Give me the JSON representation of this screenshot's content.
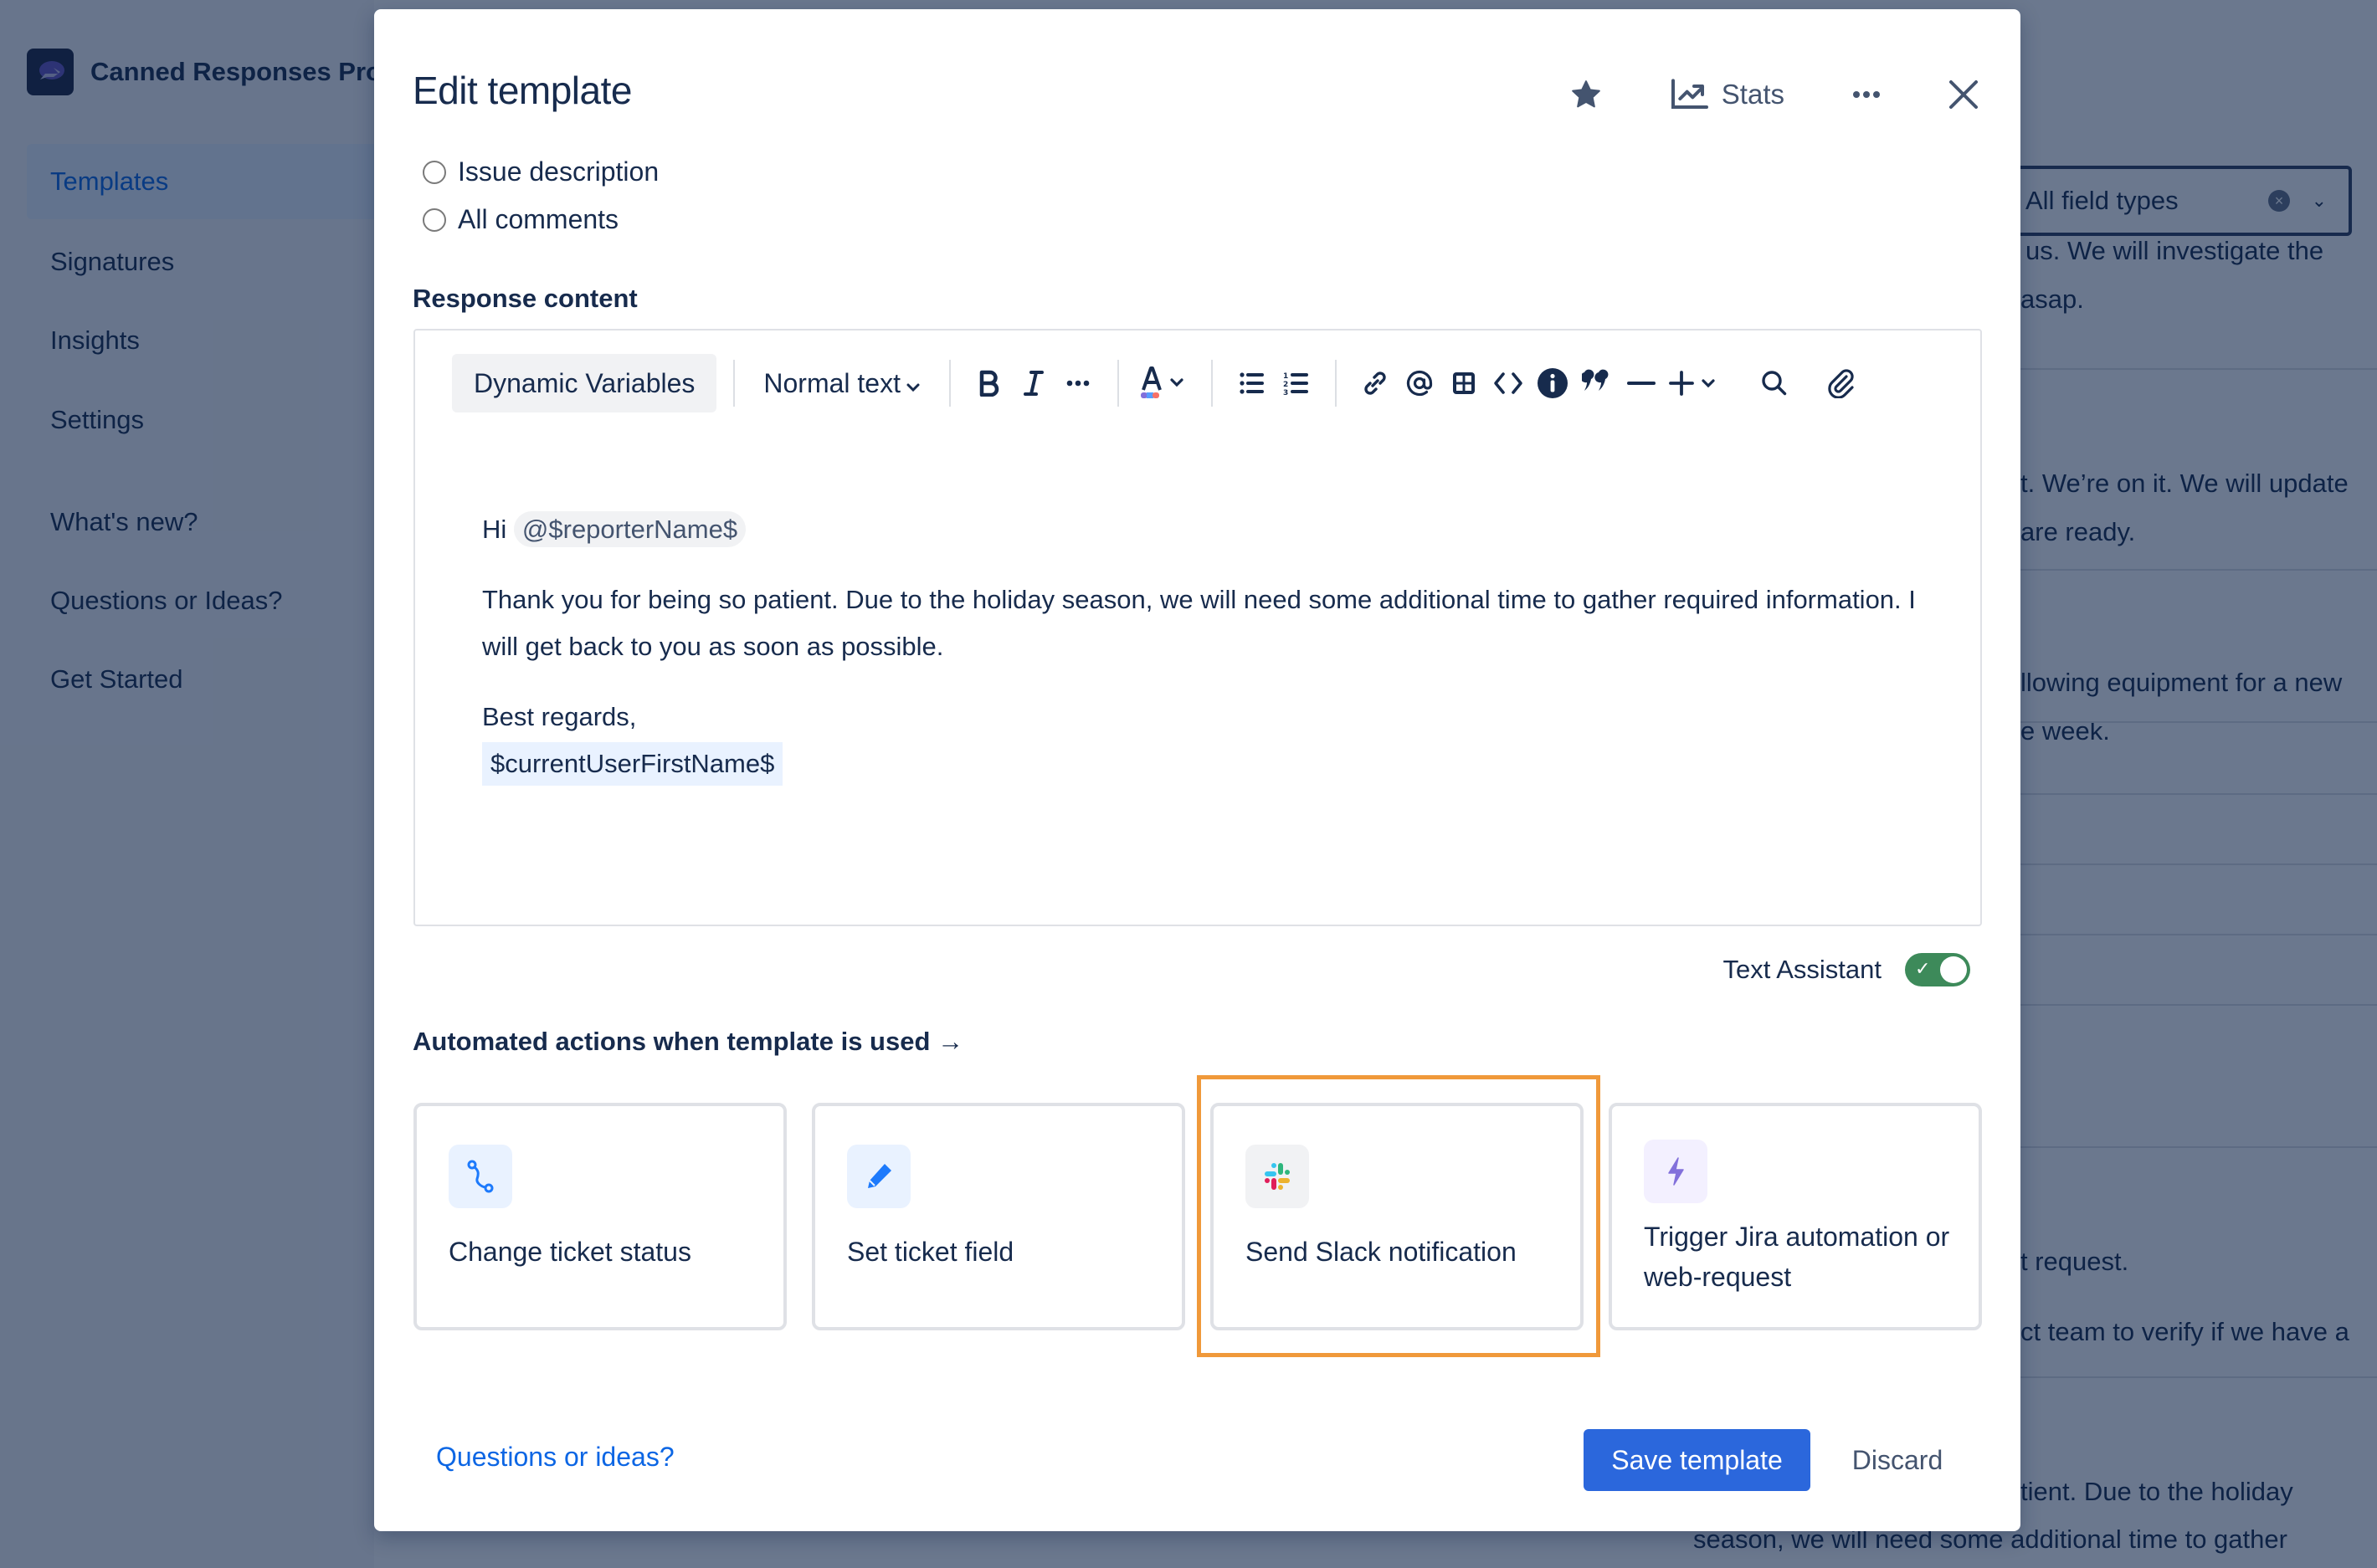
{
  "app": {
    "name": "Canned Responses Pro",
    "sidebar": {
      "items": [
        {
          "label": "Templates",
          "active": true
        },
        {
          "label": "Signatures"
        },
        {
          "label": "Insights"
        },
        {
          "label": "Settings"
        },
        {
          "label": "What's new?"
        },
        {
          "label": "Questions or Ideas?"
        },
        {
          "label": "Get Started"
        }
      ]
    },
    "background": {
      "filter_select": {
        "value": "All field types"
      },
      "snippets": [
        "us. We will investigate the",
        "asap.",
        "t. We’re on it. We will update",
        "are ready.",
        "llowing equipment for a new",
        "e week.",
        "t request.",
        "ct team to verify if we have a",
        "tient. Due to the holiday",
        "season, we will need some additional time to gather"
      ]
    }
  },
  "modal": {
    "title": "Edit template",
    "header_actions": {
      "favorite_icon": "star-icon",
      "stats_label": "Stats",
      "more_icon": "ellipsis-icon",
      "close_icon": "close-icon"
    },
    "radio_options": [
      {
        "label": "Issue description",
        "checked": false
      },
      {
        "label": "All comments",
        "checked": false
      }
    ],
    "response_content_label": "Response content",
    "toolbar": {
      "dynamic_variables": "Dynamic Variables",
      "text_style": "Normal text",
      "icons": [
        "bold-icon",
        "italic-icon",
        "more-formatting-icon",
        "text-color-icon",
        "bullet-list-icon",
        "numbered-list-icon",
        "link-icon",
        "mention-icon",
        "table-icon",
        "code-icon",
        "info-panel-icon",
        "quote-icon",
        "divider-icon",
        "insert-plus-icon",
        "search-icon",
        "attachment-icon"
      ]
    },
    "editor": {
      "greeting": "Hi",
      "mention": "@$reporterName$",
      "paragraph": "Thank you for being so patient. Due to the holiday season, we will need some additional time to gather required information. I will get back to you as soon as possible.",
      "closing": "Best regards,",
      "signature_variable": "$currentUserFirstName$"
    },
    "text_assistant": {
      "label": "Text Assistant",
      "enabled": true
    },
    "automated_actions": {
      "heading": "Automated actions when template is used →",
      "cards": [
        {
          "label": "Change ticket status",
          "icon": "status-transition-icon"
        },
        {
          "label": "Set ticket field",
          "icon": "pencil-icon"
        },
        {
          "label": "Send Slack notification",
          "icon": "slack-icon",
          "highlighted": true
        },
        {
          "label": "Trigger Jira automation or web-request",
          "icon": "lightning-icon"
        }
      ]
    },
    "footer": {
      "help_link": "Questions or ideas?",
      "save_label": "Save template",
      "discard_label": "Discard"
    }
  },
  "colors": {
    "primary": "#2b67dc",
    "link": "#0c66e4",
    "text": "#172b4d",
    "toggle_on": "#3d8a5a",
    "highlight": "#f0993a"
  }
}
